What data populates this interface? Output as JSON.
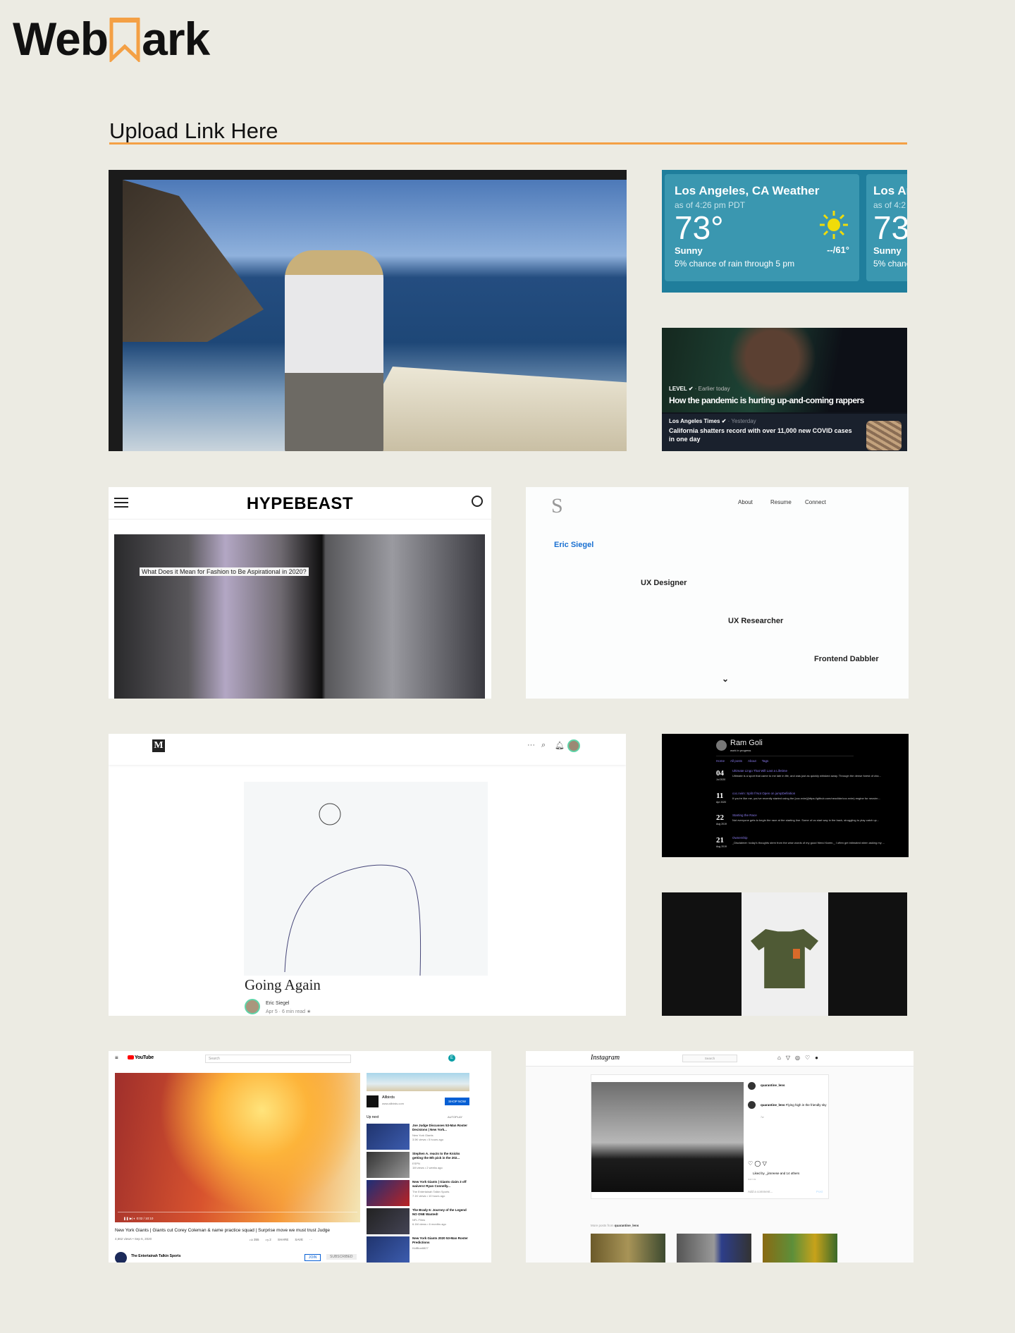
{
  "brand": {
    "name_left": "Web",
    "name_right": "ark",
    "accent": "#f4a045"
  },
  "section_title": "Upload Link Here",
  "weather": {
    "city": "Los Angeles, CA Weather",
    "as_of": "as of 4:26 pm PDT",
    "temp": "73°",
    "condition": "Sunny",
    "hi_lo": "--/61°",
    "rain": "5% chance of rain through 5 pm",
    "icon": "sun-icon",
    "peek_city": "Los An",
    "peek_as_of": "as of 4:2",
    "peek_temp": "73",
    "peek_cond": "Sunny",
    "peek_rain": "5% chanc"
  },
  "news": {
    "source": "LEVEL",
    "time": "· Earlier today",
    "headline": "How the pandemic is hurting up-and-coming rappers",
    "sub_source": "Los Angeles Times",
    "sub_time": "· Yesterday",
    "sub_headline": "California shatters record with over 11,000 new COVID cases in one day"
  },
  "hypebeast": {
    "logo": "HYPEBEAST",
    "caption": "What Does it Mean for Fashion to Be Aspirational in 2020?"
  },
  "eric": {
    "logo": "S",
    "nav": [
      "About",
      "Resume",
      "Connect"
    ],
    "name": "Eric Siegel",
    "roles": [
      "UX Designer",
      "UX Researcher",
      "Frontend Dabbler"
    ],
    "chevron": "⌄"
  },
  "medium": {
    "logo": "M",
    "title": "Going Again",
    "author": "Eric Siegel",
    "meta": "Apr 5 · 6 min read ★",
    "more": "···"
  },
  "ramgoli": {
    "name": "Ram Goli",
    "tagline": "work in progress",
    "nav": [
      "Home",
      "All posts",
      "About",
      "Tags"
    ],
    "posts": [
      {
        "day": "04",
        "month": "Jul 2020",
        "title": "Ultimate Lingo That Will Last a Lifetime",
        "excerpt": "Ultimate is a sport that came to me late in life, and was just as quickly whisked away. Through the dense forest of cha..."
      },
      {
        "day": "11",
        "month": "Apr 2020",
        "title": "coc.nvim: Split If Not Open on jumpDefinition",
        "excerpt": "If you're like me, you've recently started using the [coc.nvim](https://github.com/neoclide/coc.nvim) engine for neovim..."
      },
      {
        "day": "22",
        "month": "Aug 2019",
        "title": "Starting the Race",
        "excerpt": "Not everyone gets to begin the race at the starting line. Some of us start way in the back, struggling to play catch up..."
      },
      {
        "day": "21",
        "month": "Aug 2019",
        "title": "Ownership",
        "excerpt": "_Disclaimer: today's thoughts stem from the wise words of my good friend Karen._ I often get intimated when asking my ..."
      }
    ]
  },
  "youtube": {
    "logo": "YouTube",
    "search_placeholder": "Search",
    "avatar_letter": "E",
    "time": "0:02 / 10:10",
    "title": "New York Giants | Giants cut Corey Coleman & name practice squad | Surprise move we must trust Judge",
    "meta": "4,662 views • Sep 6, 2020",
    "likes": "355",
    "dislikes": "2",
    "share": "SHARE",
    "save": "SAVE",
    "channel": "The Entertainah Talkin Sports",
    "join": "JOIN",
    "subscribed": "SUBSCRIBED",
    "ad": {
      "name": "Allbirds",
      "url": "www.allbirds.com",
      "cta": "SHOP NOW"
    },
    "up_next": "Up next",
    "autoplay": "AUTOPLAY",
    "items": [
      {
        "title": "Joe Judge Discusses 53-Man Roster Decisions | New York...",
        "channel": "New York Giants",
        "meta": "3.5K views • 5 hours ago"
      },
      {
        "title": "Stephen A. reacts to the Knicks getting the 8th pick in the 202...",
        "channel": "ESPN",
        "meta": "1M views • 2 weeks ago"
      },
      {
        "title": "New York Giants | Giants claim 3 off waivers! Ryan Connelly...",
        "channel": "The Entertainah Talkin Sports",
        "meta": "7.1K views • 10 hours ago"
      },
      {
        "title": "The Brady 6: Journey of the Legend NO ONE Wanted!",
        "channel": "NFL Films",
        "meta": "6.1M views • 6 months ago"
      },
      {
        "title": "New York Giants 2020 53-Man Roster Predictions",
        "channel": "KidBlue8827",
        "meta": ""
      }
    ]
  },
  "instagram": {
    "logo": "Instagram",
    "search_placeholder": "Search",
    "user": "quarantine_lens",
    "caption": "Flying high in the friendly sky",
    "age": "7w",
    "liked_by": "Liked by _jimreese and 14 others",
    "date": "JULY 19",
    "add_comment": "Add a comment...",
    "post": "Post",
    "more_from": "More posts from",
    "more_user": "quarantine_lens"
  }
}
